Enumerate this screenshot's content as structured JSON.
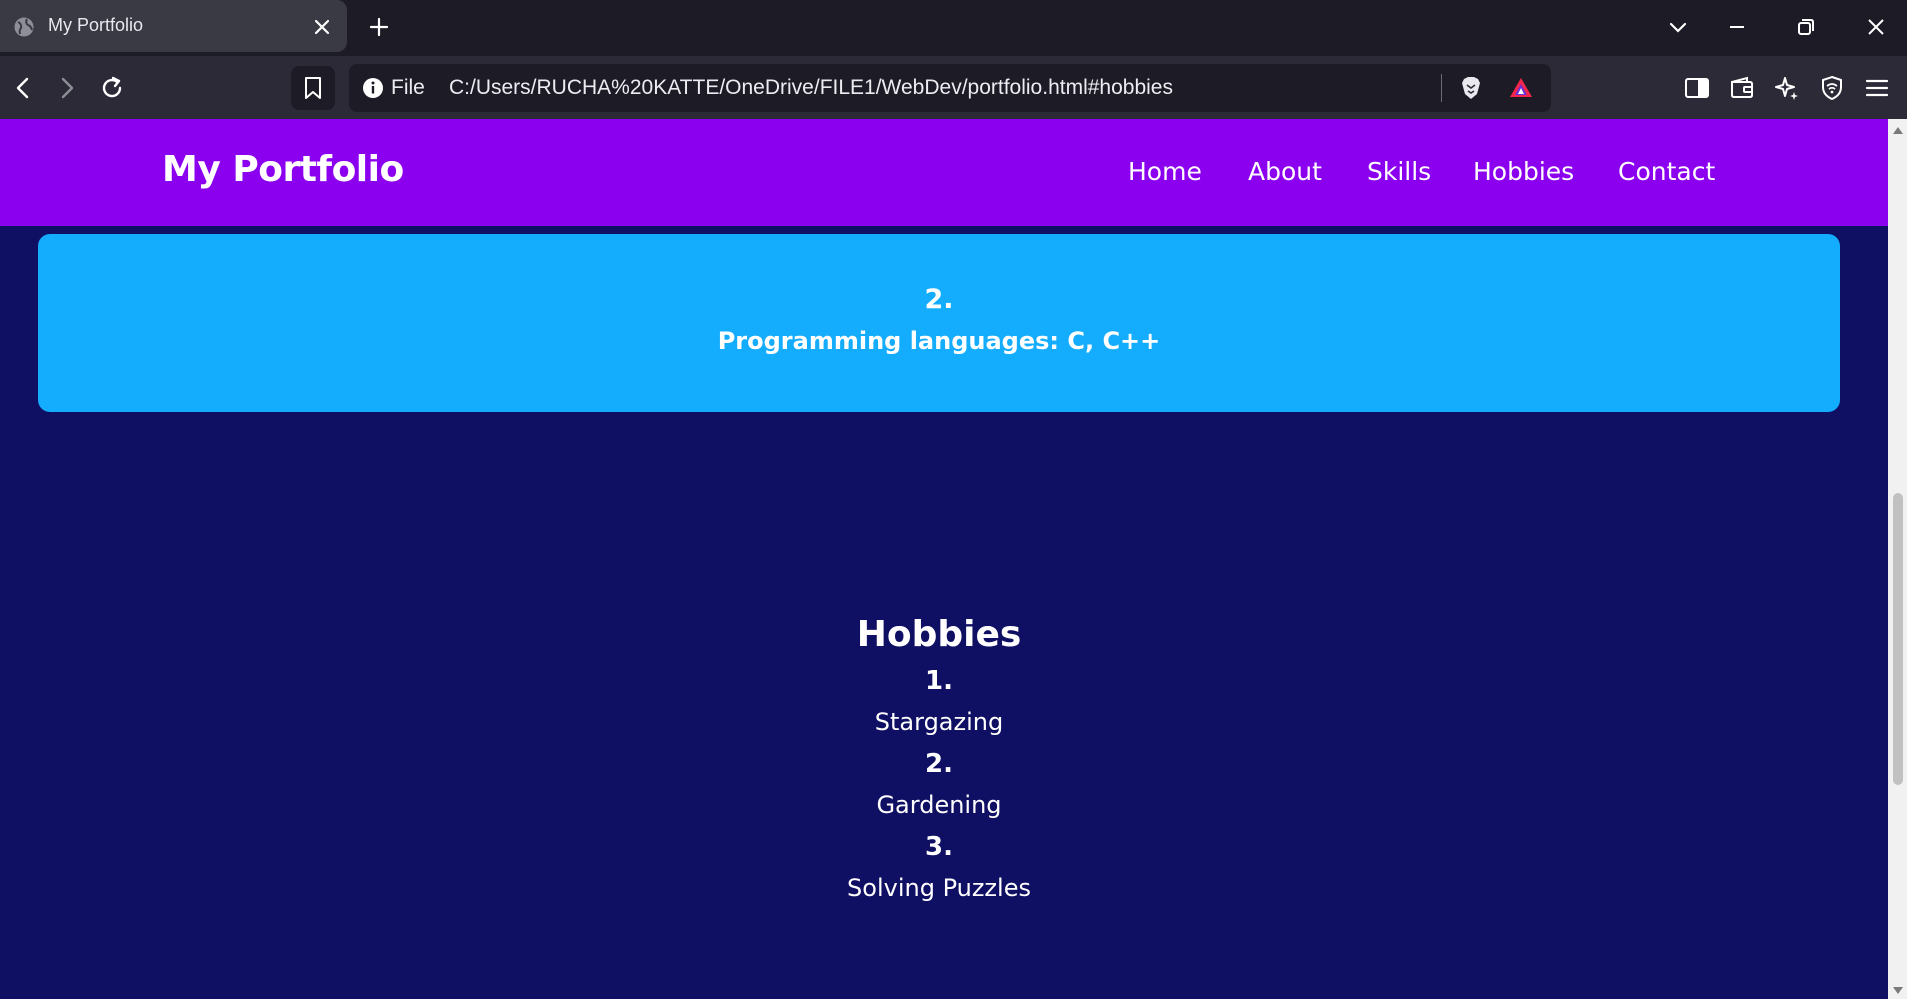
{
  "browser": {
    "tab_title": "My Portfolio",
    "url_scheme": "File",
    "url": "C:/Users/RUCHA%20KATTE/OneDrive/FILE1/WebDev/portfolio.html#hobbies"
  },
  "page": {
    "brand": "My Portfolio",
    "nav": [
      "Home",
      "About",
      "Skills",
      "Hobbies",
      "Contact"
    ],
    "skill_card": {
      "number": "2.",
      "text": "Programming languages: C, C++"
    },
    "hobbies": {
      "title": "Hobbies",
      "items": [
        {
          "number": "1.",
          "name": "Stargazing"
        },
        {
          "number": "2.",
          "name": "Gardening"
        },
        {
          "number": "3.",
          "name": "Solving Puzzles"
        }
      ]
    }
  },
  "colors": {
    "navbar": "#8c00f0",
    "page_bg": "#0f0f63",
    "skill_card": "#14acfc"
  }
}
